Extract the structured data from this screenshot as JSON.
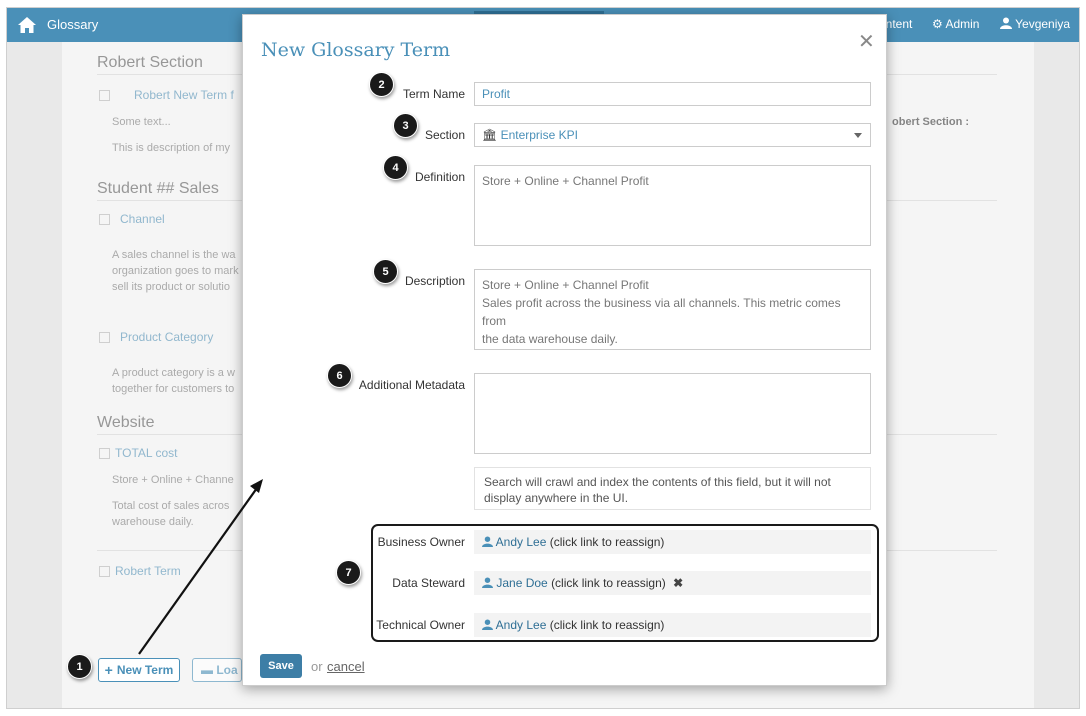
{
  "topbar": {
    "app_title": "Glossary",
    "content_label": "ontent",
    "admin_label": "Admin",
    "user_label": "Yevgeniya"
  },
  "background": {
    "section1_title": "Robert Section",
    "term1": "Robert New Term f",
    "term1_text1": "Some text...",
    "term1_text2": "This is description of my",
    "section1_side": "obert Section :",
    "section2_title": "Student ## Sales",
    "term2": "Channel",
    "term2_text1": "A sales channel is the wa",
    "term2_text2": "organization goes to mark",
    "term2_text3": "sell its product or solutio",
    "term3": "Product Category",
    "term3_text1": "A product category is a w",
    "term3_text2": "together for customers to",
    "section3_title": "Website",
    "term4": "TOTAL cost",
    "term4_text1": "Store + Online + Channe",
    "term4_text2": "Total cost of sales acros",
    "term4_text3": "warehouse daily.",
    "term5": "Robert Term",
    "new_term_button": "New Term",
    "load_button": "Loa"
  },
  "modal": {
    "title": "New Glossary Term",
    "close_symbol": "✕",
    "term_name_label": "Term Name",
    "term_name_value": "Profit",
    "section_label": "Section",
    "section_value": "Enterprise KPI",
    "definition_label": "Definition",
    "definition_value": "Store + Online + Channel Profit",
    "description_label": "Description",
    "description_line1": "Store + Online + Channel Profit",
    "description_line2": "Sales profit across the business via all channels. This metric comes from",
    "description_line3": "the data warehouse daily.",
    "metadata_label": "Additional Metadata",
    "metadata_value": "",
    "help_text": "Search will crawl and index the contents of this field, but it will not display anywhere in the UI.",
    "business_owner_label": "Business Owner",
    "business_owner_name": "Andy Lee",
    "business_owner_hint": "(click link to reassign)",
    "data_steward_label": "Data Steward",
    "data_steward_name": "Jane Doe",
    "data_steward_hint": "(click link to reassign)",
    "technical_owner_label": "Technical Owner",
    "technical_owner_name": "Andy Lee",
    "technical_owner_hint": "(click link to reassign)",
    "save_label": "Save",
    "or_text": "or",
    "cancel_label": "cancel"
  },
  "callouts": [
    "1",
    "2",
    "3",
    "4",
    "5",
    "6",
    "7"
  ],
  "colors": {
    "topbar": "#4a90b8",
    "accent": "#4a90b8",
    "save_button": "#3d7ea6",
    "callout": "#1a1a1a"
  }
}
